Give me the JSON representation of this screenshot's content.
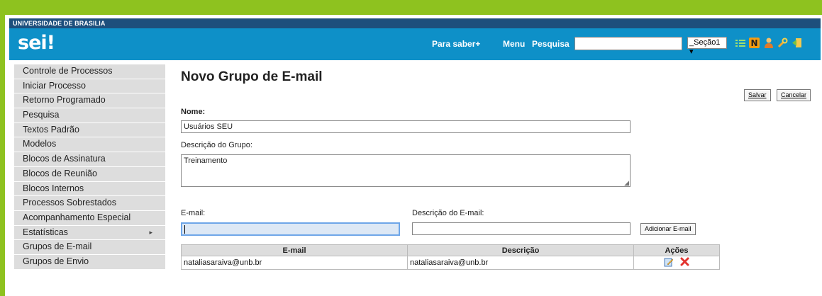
{
  "header": {
    "university": "UNIVERSIDADE DE BRASILIA",
    "logo_text": "sei",
    "logo_mark": "!",
    "nav": [
      "Para saber+",
      "Menu",
      "Pesquisa"
    ],
    "search_value": "",
    "section_select": "_Seção1",
    "icons": [
      "list-icon",
      "notification-n-icon",
      "user-icon",
      "wrench-icon",
      "exit-icon"
    ]
  },
  "sidebar": {
    "items": [
      {
        "label": "Controle de Processos"
      },
      {
        "label": "Iniciar Processo"
      },
      {
        "label": "Retorno Programado"
      },
      {
        "label": "Pesquisa"
      },
      {
        "label": "Textos Padrão"
      },
      {
        "label": "Modelos"
      },
      {
        "label": "Blocos de Assinatura"
      },
      {
        "label": "Blocos de Reunião"
      },
      {
        "label": "Blocos Internos"
      },
      {
        "label": "Processos Sobrestados"
      },
      {
        "label": "Acompanhamento Especial"
      },
      {
        "label": "Estatísticas",
        "arrow": "▸"
      },
      {
        "label": "Grupos de E-mail"
      },
      {
        "label": "Grupos de Envio"
      }
    ]
  },
  "page": {
    "title": "Novo Grupo de E-mail",
    "save_label": "Salvar",
    "cancel_label": "Cancelar",
    "nome_label": "Nome:",
    "nome_value": "Usuários SEU",
    "descricao_label": "Descrição do Grupo:",
    "descricao_value": "Treinamento",
    "email_label": "E-mail:",
    "email_value": "",
    "email_desc_label": "Descrição do E-mail:",
    "email_desc_value": "",
    "add_email_label": "Adicionar E-mail"
  },
  "table": {
    "headers": [
      "E-mail",
      "Descrição",
      "Ações"
    ],
    "rows": [
      {
        "email": "nataliasaraiva@unb.br",
        "descricao": "nataliasaraiva@unb.br",
        "actions": [
          "edit-icon",
          "delete-icon"
        ]
      }
    ]
  },
  "colors": {
    "outer_frame": "#8ec21f",
    "topbar": "#1d4f7c",
    "header": "#0e90c8",
    "sidebar_item": "#dddddd"
  }
}
